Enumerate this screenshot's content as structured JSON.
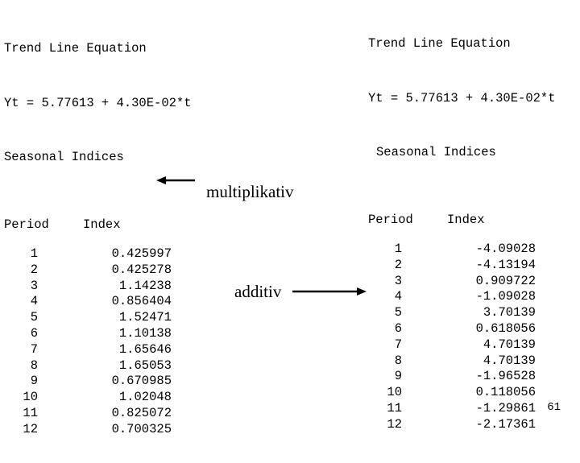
{
  "slide": {
    "background_color": "#ffffff",
    "text_color": "#000000",
    "page_number": "61"
  },
  "left_block": {
    "title": "Trend Line Equation",
    "equation": "Yt = 5.77613 + 4.30E-02*t",
    "subtitle": "Seasonal Indices",
    "columns": {
      "period": "Period",
      "index": "Index"
    },
    "rows": [
      {
        "period": "1",
        "index": "0.425997"
      },
      {
        "period": "2",
        "index": "0.425278"
      },
      {
        "period": "3",
        "index": "1.14238"
      },
      {
        "period": "4",
        "index": "0.856404"
      },
      {
        "period": "5",
        "index": "1.52471"
      },
      {
        "period": "6",
        "index": "1.10138"
      },
      {
        "period": "7",
        "index": "1.65646"
      },
      {
        "period": "8",
        "index": "1.65053"
      },
      {
        "period": "9",
        "index": "0.670985"
      },
      {
        "period": "10",
        "index": "1.02048"
      },
      {
        "period": "11",
        "index": "0.825072"
      },
      {
        "period": "12",
        "index": "0.700325"
      }
    ]
  },
  "right_block": {
    "title": "Trend Line Equation",
    "equation": "Yt = 5.77613 + 4.30E-02*t",
    "subtitle": "Seasonal Indices",
    "columns": {
      "period": "Period",
      "index": "Index"
    },
    "rows": [
      {
        "period": "1",
        "index": "-4.09028"
      },
      {
        "period": "2",
        "index": "-4.13194"
      },
      {
        "period": "3",
        "index": "0.909722"
      },
      {
        "period": "4",
        "index": "-1.09028"
      },
      {
        "period": "5",
        "index": "3.70139"
      },
      {
        "period": "6",
        "index": "0.618056"
      },
      {
        "period": "7",
        "index": "4.70139"
      },
      {
        "period": "8",
        "index": "4.70139"
      },
      {
        "period": "9",
        "index": "-1.96528"
      },
      {
        "period": "10",
        "index": "0.118056"
      },
      {
        "period": "11",
        "index": "-1.29861"
      },
      {
        "period": "12",
        "index": "-2.17361"
      }
    ]
  },
  "annotations": {
    "multiplicative_label": "multiplikativ",
    "additive_label": "additiv"
  }
}
